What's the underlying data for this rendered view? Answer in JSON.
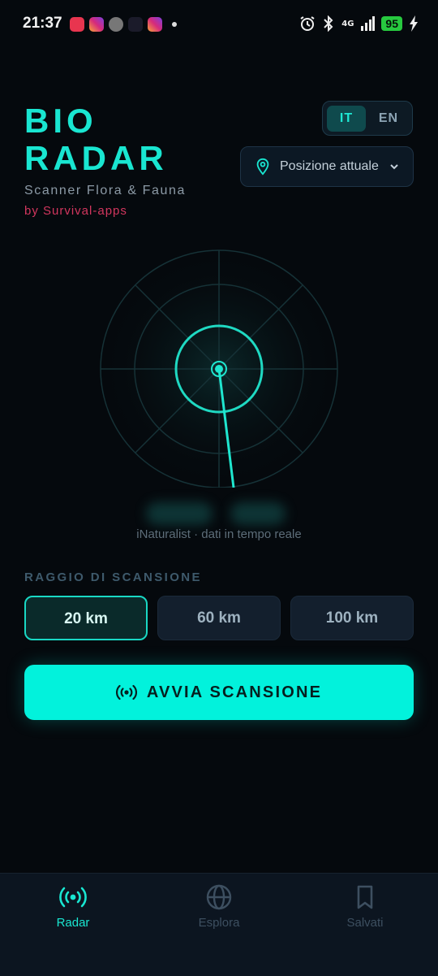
{
  "status_bar": {
    "time": "21:37",
    "network": "4G",
    "battery": "95",
    "icons": [
      "alarm-icon",
      "bluetooth-icon",
      "signal-icon",
      "charging-icon"
    ]
  },
  "header": {
    "logo_line1": "BIO",
    "logo_line2": "RADAR",
    "subtitle": "Scanner Flora & Fauna",
    "byline": "by Survival-apps"
  },
  "language": {
    "options": [
      "IT",
      "EN"
    ],
    "selected": "IT"
  },
  "location": {
    "label": "Posizione attuale",
    "icon": "map-pin-icon"
  },
  "radar": {
    "source_text": "iNaturalist · dati in tempo reale"
  },
  "range": {
    "label": "RAGGIO DI SCANSIONE",
    "options": [
      "20 km",
      "60 km",
      "100 km"
    ],
    "selected": "20 km"
  },
  "scan_button": {
    "label": "AVVIA SCANSIONE",
    "icon": "broadcast-icon"
  },
  "nav": {
    "items": [
      {
        "label": "Radar",
        "icon": "radar-icon",
        "active": true
      },
      {
        "label": "Esplora",
        "icon": "globe-icon",
        "active": false
      },
      {
        "label": "Salvati",
        "icon": "bookmark-icon",
        "active": false
      }
    ]
  },
  "colors": {
    "accent": "#19e6d1",
    "background": "#05090d",
    "byline": "#d2365e",
    "button": "#02f2dc"
  }
}
